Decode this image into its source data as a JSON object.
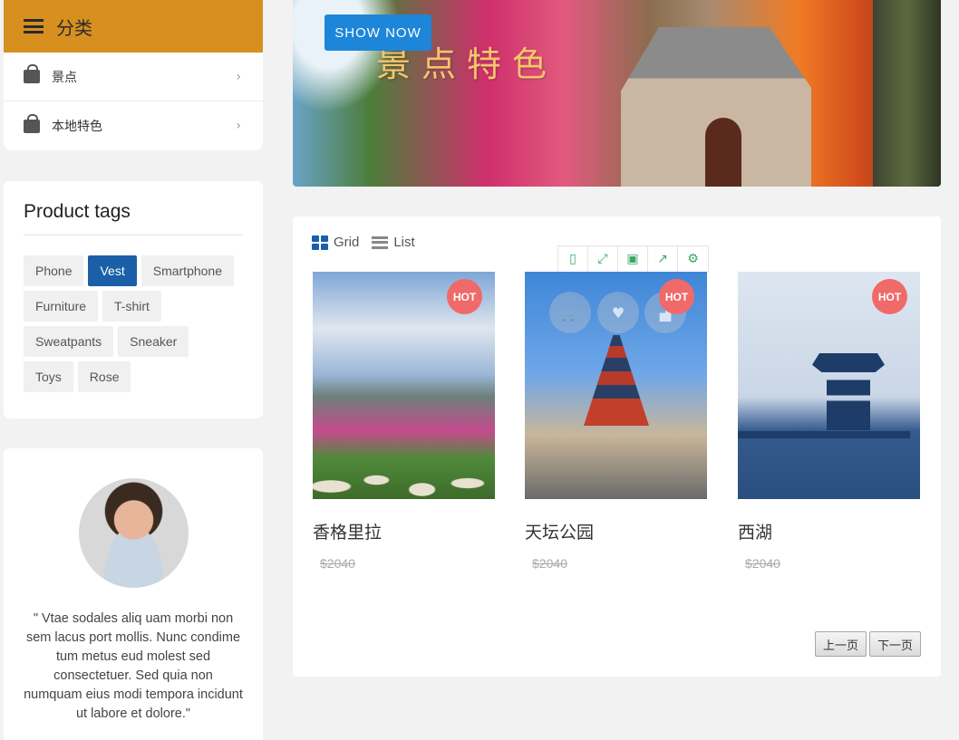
{
  "sidebar": {
    "category": {
      "title": "分类",
      "items": [
        {
          "label": "景点",
          "icon": "shopping-bag-icon"
        },
        {
          "label": "本地特色",
          "icon": "shopping-bag-icon"
        }
      ]
    },
    "tags": {
      "title": "Product tags",
      "items": [
        "Phone",
        "Vest",
        "Smartphone",
        "Furniture",
        "T-shirt",
        "Sweatpants",
        "Sneaker",
        "Toys",
        "Rose"
      ],
      "active": "Vest"
    },
    "bio": {
      "quote": "\" Vtae sodales aliq uam morbi non sem lacus port mollis. Nunc condime tum metus eud molest sed consectetuer. Sed quia non numquam eius modi tempora incidunt ut labore et dolore.\""
    }
  },
  "banner": {
    "button_label": "SHOW NOW",
    "title": "景点特色"
  },
  "products": {
    "view": {
      "grid_label": "Grid",
      "list_label": "List"
    },
    "toolbar": [
      "mobile-icon",
      "fullscreen-icon",
      "save-icon",
      "share-icon",
      "settings-icon"
    ],
    "badge": "HOT",
    "items": [
      {
        "name": "香格里拉",
        "price": "$2040"
      },
      {
        "name": "天坛公园",
        "price": "$2040"
      },
      {
        "name": "西湖",
        "price": "$2040"
      }
    ],
    "pager": {
      "prev": "上一页",
      "next": "下一页"
    }
  },
  "colors": {
    "category_header": "#d78f1f",
    "active_tag": "#1a5fa8",
    "banner_button": "#1d86d9",
    "hot_badge": "#f06a6a",
    "toolbar_icon": "#3aa865"
  }
}
